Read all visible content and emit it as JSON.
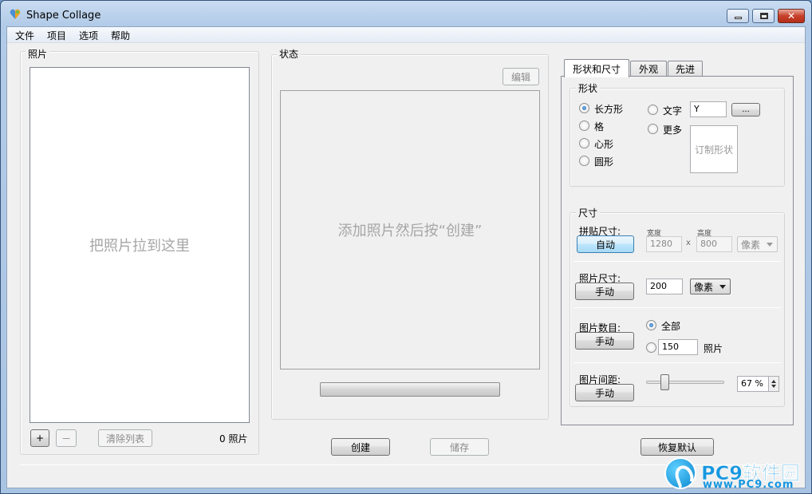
{
  "window": {
    "title": "Shape Collage",
    "minimize_glyph": "",
    "close_glyph": "✕"
  },
  "menu": [
    "文件",
    "项目",
    "选项",
    "帮助"
  ],
  "photos": {
    "legend": "照片",
    "drop_hint": "把照片拉到这里",
    "add_label": "+",
    "remove_label": "－",
    "clear_label": "清除列表",
    "count": "0 照片"
  },
  "status": {
    "legend": "状态",
    "edit_label": "编辑",
    "hint": "添加照片然后按“创建”",
    "progress": 0
  },
  "actions": {
    "create": "创建",
    "save": "储存",
    "reset": "恢复默认"
  },
  "tabs": [
    "形状和尺寸",
    "外观",
    "先进"
  ],
  "shape": {
    "legend": "形状",
    "options": [
      "长方形",
      "格",
      "心形",
      "圆形"
    ],
    "selected": "长方形",
    "text_label": "文字",
    "text_value": "Y",
    "browse_label": "...",
    "more_label": "更多",
    "custom_label": "订制形状"
  },
  "size": {
    "legend": "尺寸",
    "collage": {
      "label": "拼贴尺寸:",
      "button": "自动",
      "width_label": "宽度",
      "height_label": "高度",
      "width": "1280",
      "x": "x",
      "height": "800",
      "unit": "像素"
    },
    "photo": {
      "label": "照片尺寸:",
      "button": "手动",
      "value": "200",
      "unit": "像素"
    },
    "count": {
      "label": "图片数目:",
      "button": "手动",
      "all_label": "全部",
      "value": "150",
      "unit": "照片"
    },
    "spacing": {
      "label": "图片间距:",
      "button": "手动",
      "value": "67 %",
      "slider_level": 0.21
    }
  },
  "watermark": {
    "title": "PC9软件园",
    "url": "www.PC9.com"
  },
  "colors": {
    "title_bar": "#b2cbe8",
    "close_button": "#c7402a",
    "watermark": "#1697e0"
  }
}
